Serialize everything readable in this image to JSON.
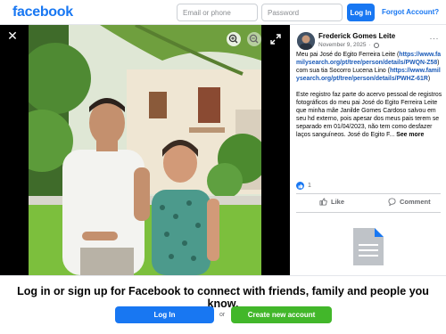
{
  "header": {
    "logo": "facebook",
    "email_placeholder": "Email or phone",
    "password_placeholder": "Password",
    "login_label": "Log In",
    "forgot_label": "Forgot Account?"
  },
  "viewer": {
    "close_symbol": "✕"
  },
  "post": {
    "author": "Frederick Gomes Leite",
    "date": "November 9, 2025",
    "more_symbol": "···",
    "caption": {
      "part1": "Meu pai José do Egito Ferreira Leite (",
      "link1": "https://www.familysearch.org/pt/tree/person/details/PWQN-Z58",
      "part2": ") com sua tia Socorro Lucena Lino (",
      "link2": "https://www.familysearch.org/pt/tree/person/details/PWHZ-61R",
      "part3": ")",
      "para2": "Este registro faz parte do acervo pessoal de registros fotográficos do meu pai José do Egito Ferreira Leite que minha mãe Janilde Gomes Cardoso salvou em seu hd externo, pois apesar dos meus pais terem se separado em 01/04/2023, não tem como desfazer laços sanguíneos. José do Egito F...",
      "see_more": "See more"
    },
    "reaction_count": "1",
    "like_label": "Like",
    "comment_label": "Comment"
  },
  "banner": {
    "text": "Log in or sign up for Facebook to connect with friends, family and people you know.",
    "login_label": "Log In",
    "or_label": "or",
    "create_label": "Create new account"
  },
  "colors": {
    "brand": "#1877f2",
    "create_green": "#42b72a",
    "link": "#1a5ab8"
  }
}
